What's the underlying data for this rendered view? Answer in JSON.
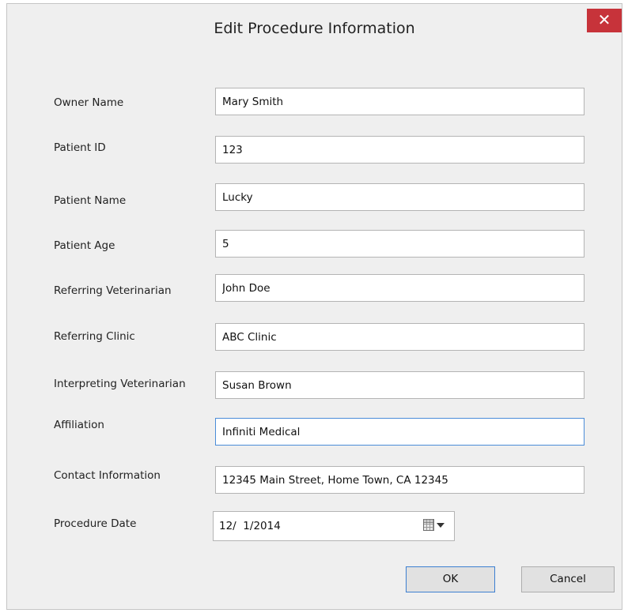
{
  "window": {
    "title": "Edit Procedure Information",
    "close_label": "✕"
  },
  "fields": [
    {
      "label": "Owner Name",
      "value": "Mary Smith"
    },
    {
      "label": "Patient ID",
      "value": "123"
    },
    {
      "label": "Patient Name",
      "value": "Lucky"
    },
    {
      "label": "Patient Age",
      "value": "5"
    },
    {
      "label": "Referring Veterinarian",
      "value": "John Doe"
    },
    {
      "label": "Referring Clinic",
      "value": "ABC Clinic"
    },
    {
      "label": "Interpreting Veterinarian",
      "value": "Susan Brown"
    },
    {
      "label": "Affiliation",
      "value": "Infiniti Medical"
    },
    {
      "label": "Contact Information",
      "value": "12345 Main Street, Home Town, CA 12345"
    }
  ],
  "procedure_date": {
    "label": "Procedure Date",
    "value": "12/  1/2014",
    "calendar_icon": "calendar-dropdown-icon"
  },
  "buttons": {
    "ok_label": "OK",
    "cancel_label": "Cancel"
  },
  "colors": {
    "close_button": "#c7333a",
    "focus_border": "#4a8cd8",
    "dialog_background": "#efefef"
  }
}
